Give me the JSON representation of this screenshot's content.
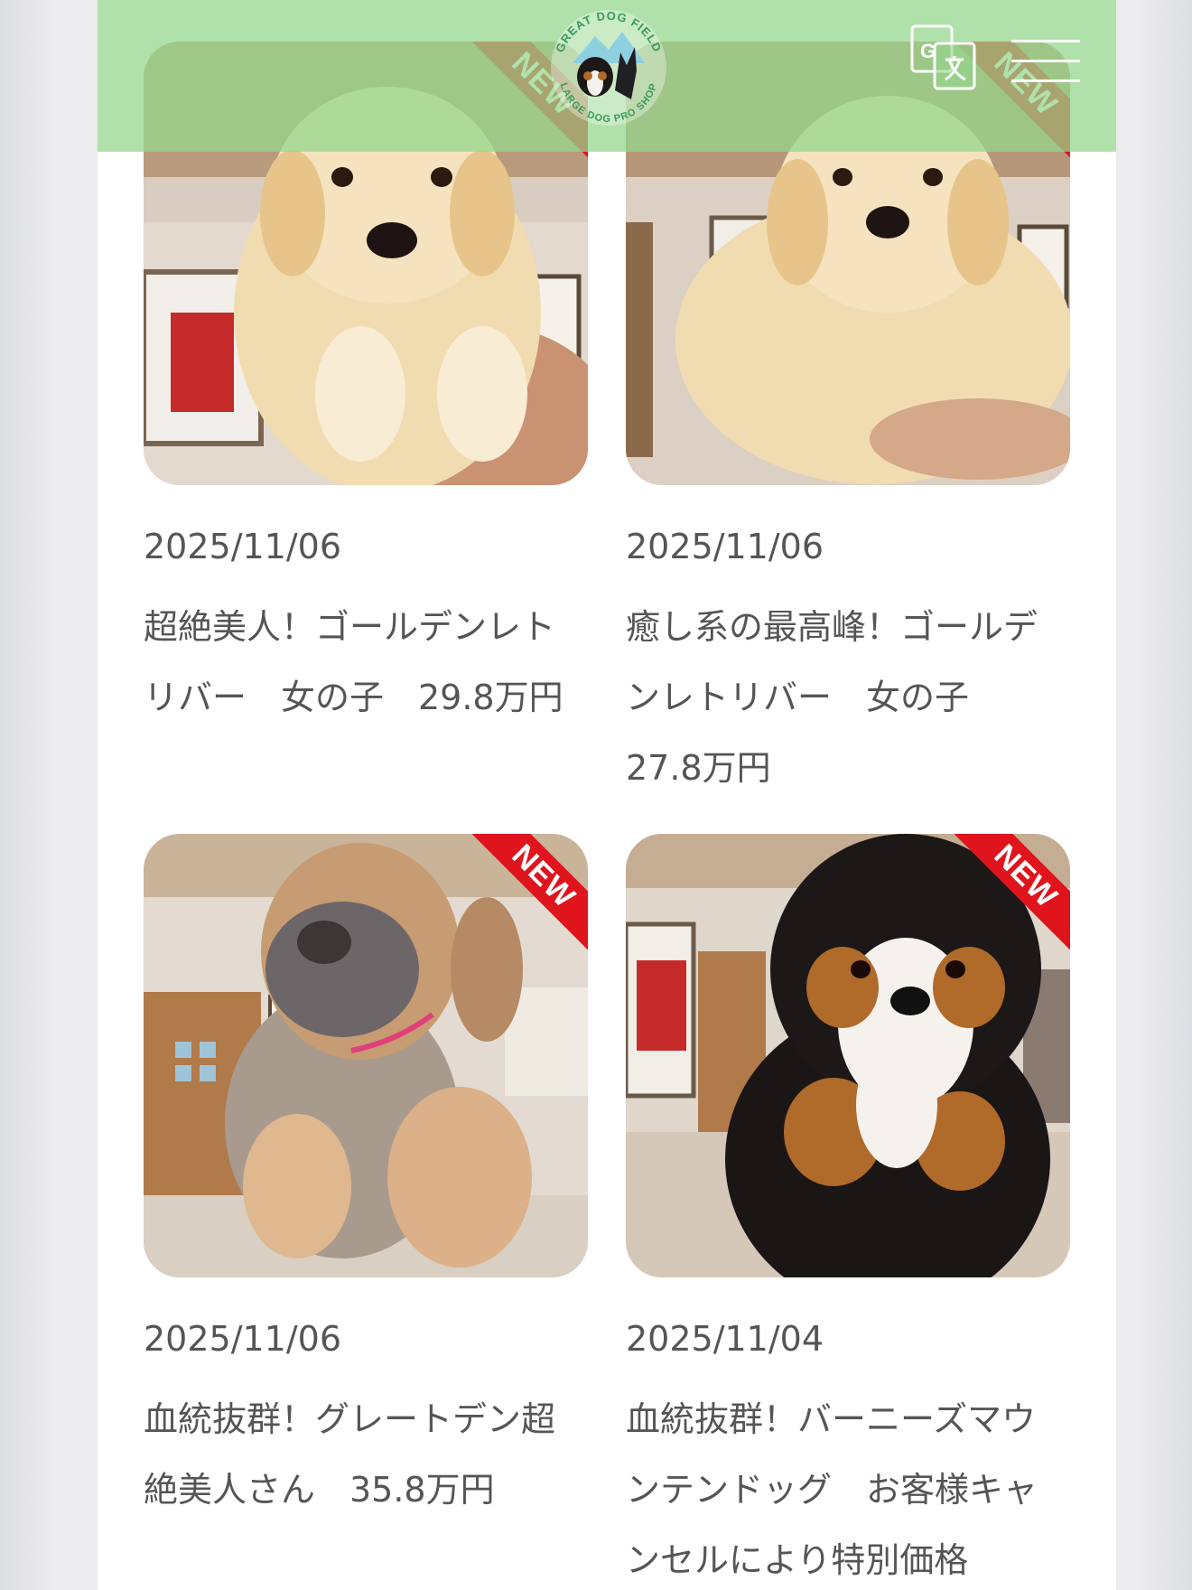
{
  "header": {
    "logo_top_text": "GREAT DOG FIELD",
    "logo_bottom_text": "LARGE DOG PRO SHOP",
    "translate_icon": "google-translate-icon",
    "menu_icon": "hamburger-menu-icon"
  },
  "colors": {
    "header_green": "#94d68c",
    "ribbon_red": "#e0141d",
    "text_gray": "#555555"
  },
  "badge_label": "NEW",
  "posts": [
    {
      "date": "2025/11/06",
      "title": "超絶美人！ゴールデンレトリバー　女の子　29.8万円"
    },
    {
      "date": "2025/11/06",
      "title": "癒し系の最高峰！ゴールデンレトリバー　女の子　27.8万円"
    },
    {
      "date": "2025/11/06",
      "title": "血統抜群！グレートデン超絶美人さん　35.8万円"
    },
    {
      "date": "2025/11/04",
      "title": "血統抜群！バーニーズマウンテンドッグ　お客様キャンセルにより特別価格"
    }
  ]
}
